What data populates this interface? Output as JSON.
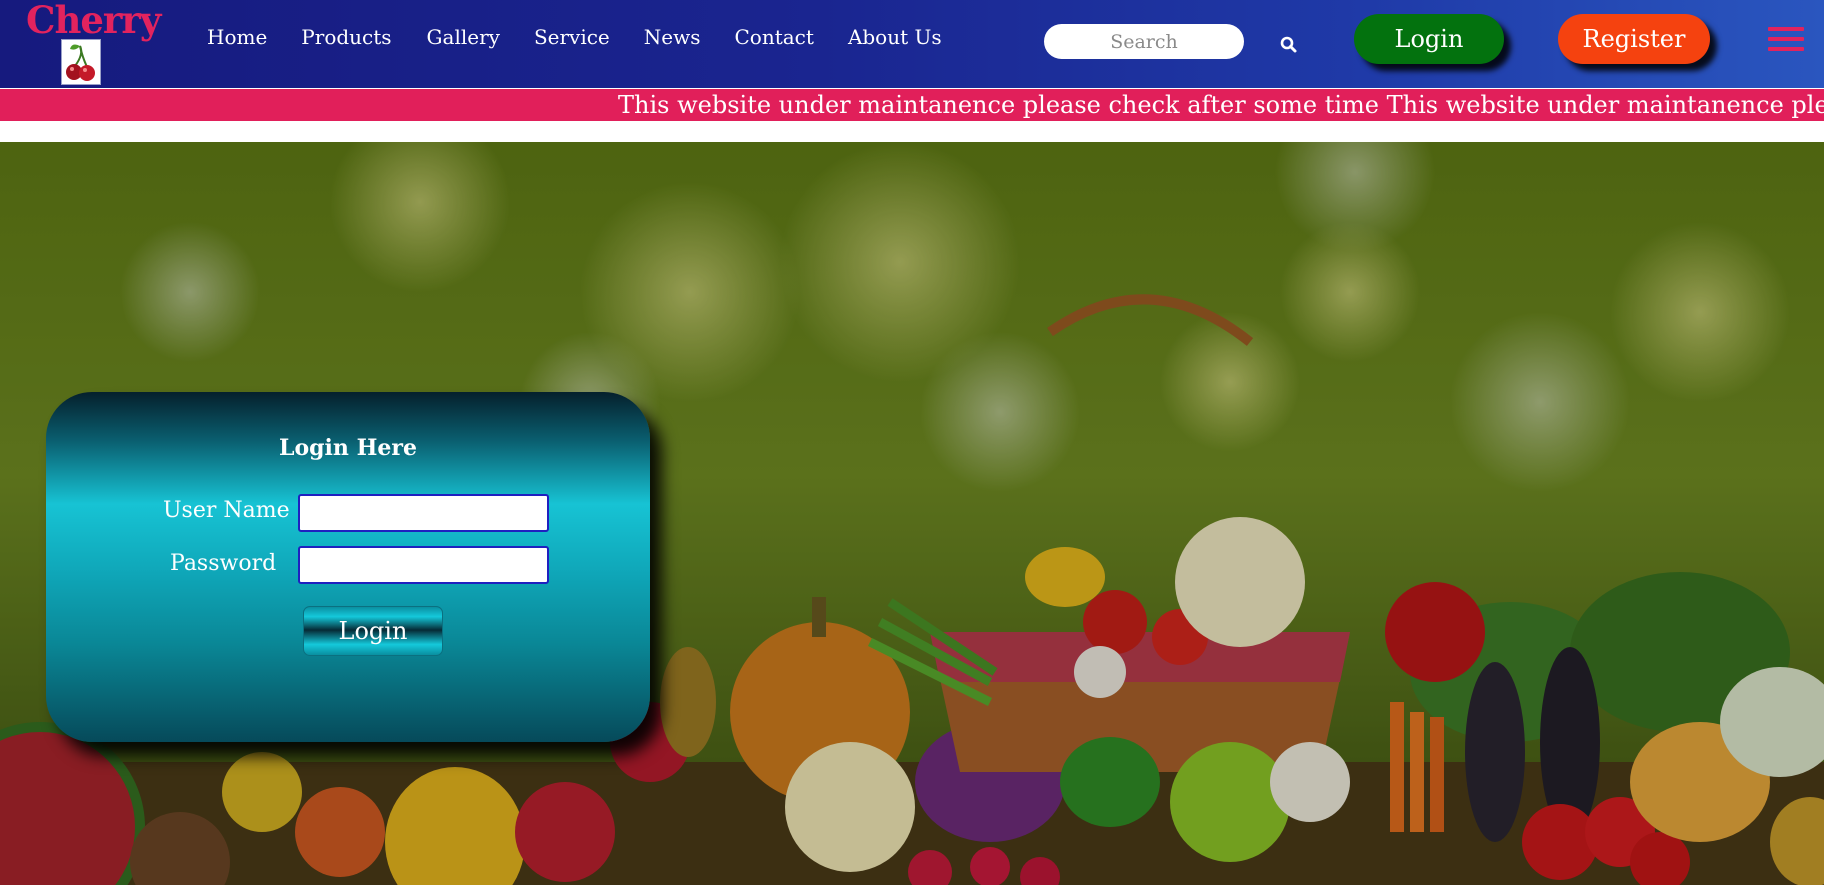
{
  "brand": {
    "name": "Cherry"
  },
  "nav": {
    "links": [
      {
        "label": "Home"
      },
      {
        "label": "Products"
      },
      {
        "label": "Gallery"
      },
      {
        "label": "Service"
      },
      {
        "label": "News"
      },
      {
        "label": "Contact"
      },
      {
        "label": "About Us"
      }
    ]
  },
  "search": {
    "placeholder": "Search",
    "value": ""
  },
  "header_buttons": {
    "login": "Login",
    "register": "Register"
  },
  "marquee": {
    "text": "This website under maintanence please check after some time This website under maintanence please check after some time"
  },
  "login_form": {
    "title": "Login Here",
    "username_label": "User Name",
    "username_value": "",
    "password_label": "Password",
    "password_value": "",
    "submit_label": "Login"
  },
  "icons": {
    "logo": "cherry-icon",
    "search": "search-icon",
    "menu": "hamburger-menu-icon"
  },
  "colors": {
    "navbar": "#1a2590",
    "brand": "#e2235e",
    "marquee_bar": "#e11f5a",
    "login_button": "#03720e",
    "register_button": "#f5420f",
    "form_accent": "#17c3d4"
  }
}
